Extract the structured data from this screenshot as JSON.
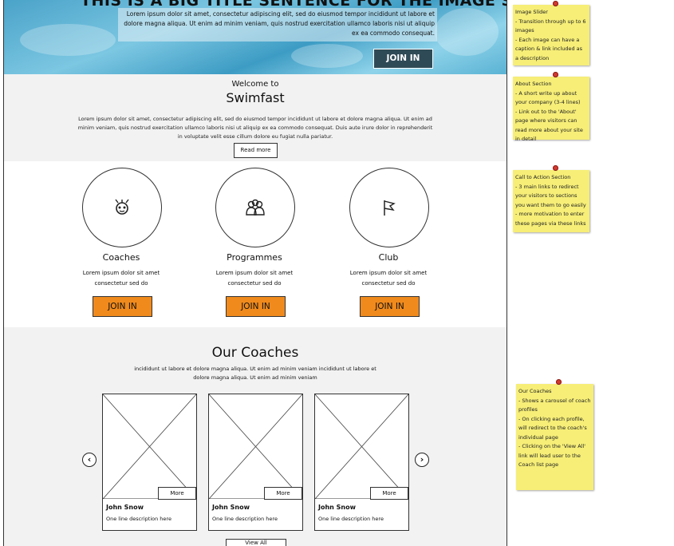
{
  "hero": {
    "title": "THIS IS A BIG TITLE SENTENCE FOR THE IMAGE SLIDER",
    "text": "Lorem ipsum dolor sit amet, consectetur adipiscing elit, sed do eiusmod tempor incididunt ut labore et dolore magna aliqua. Ut enim ad minim veniam, quis nostrud exercitation ullamco laboris nisi ut aliquip ex ea commodo consequat.",
    "join_label": "JOIN IN"
  },
  "welcome": {
    "small": "Welcome to",
    "big": "Swimfast",
    "text": "Lorem ipsum dolor sit amet, consectetur adipiscing elit, sed do eiusmod tempor incididunt ut labore et dolore magna aliqua. Ut enim ad minim veniam, quis nostrud exercitation ullamco laboris nisi ut aliquip ex ea commodo consequat. Duis aute irure dolor in reprehenderit in voluptate velit esse cillum dolore eu fugiat nulla pariatur.",
    "read_more": "Read more"
  },
  "cta": [
    {
      "title": "Coaches",
      "text": "Lorem ipsum dolor sit amet consectetur sed do",
      "join": "JOIN IN",
      "icon": "coach-icon"
    },
    {
      "title": "Programmes",
      "text": "Lorem ipsum dolor sit amet consectetur sed do",
      "join": "JOIN IN",
      "icon": "group-icon"
    },
    {
      "title": "Club",
      "text": "Lorem ipsum dolor sit amet consectetur sed do",
      "join": "JOIN IN",
      "icon": "flag-icon"
    }
  ],
  "coaches": {
    "title": "Our Coaches",
    "text": "incididunt ut labore et dolore magna aliqua. Ut enim ad minim veniam incididunt ut labore et dolore magna aliqua. Ut enim ad minim veniam",
    "cards": [
      {
        "name": "John Snow",
        "desc": "One line description here",
        "more": "More"
      },
      {
        "name": "John Snow",
        "desc": "One line description here",
        "more": "More"
      },
      {
        "name": "John Snow",
        "desc": "One line description here",
        "more": "More"
      }
    ],
    "prev_icon": "chevron-left-icon",
    "next_icon": "chevron-right-icon",
    "view_all": "View All"
  },
  "notes": [
    {
      "text": "Image Slider\n- Transition through up to 6 images\n- Each image can have a caption & link included as a description"
    },
    {
      "text": "About Section\n- A short write up about your company (3-4 lines)\n- Link out to the 'About' page where visitors can read more about your site in detail"
    },
    {
      "text": "Call to Action Section\n- 3 main links to redirect your visitors to sections you want them to go easily\n- more motivation to enter these pages via these links"
    },
    {
      "text": "Our Coaches\n- Shows a carousel of coach profiles\n- On clicking each profile, will redirect to the coach's individual page\n- Clicking on the 'View All' link will lead user to the Coach list page"
    }
  ],
  "colors": {
    "accent": "#f08a1c",
    "dark_button": "#2f4a57",
    "note": "#f6ee77",
    "pin": "#d23a2f"
  }
}
